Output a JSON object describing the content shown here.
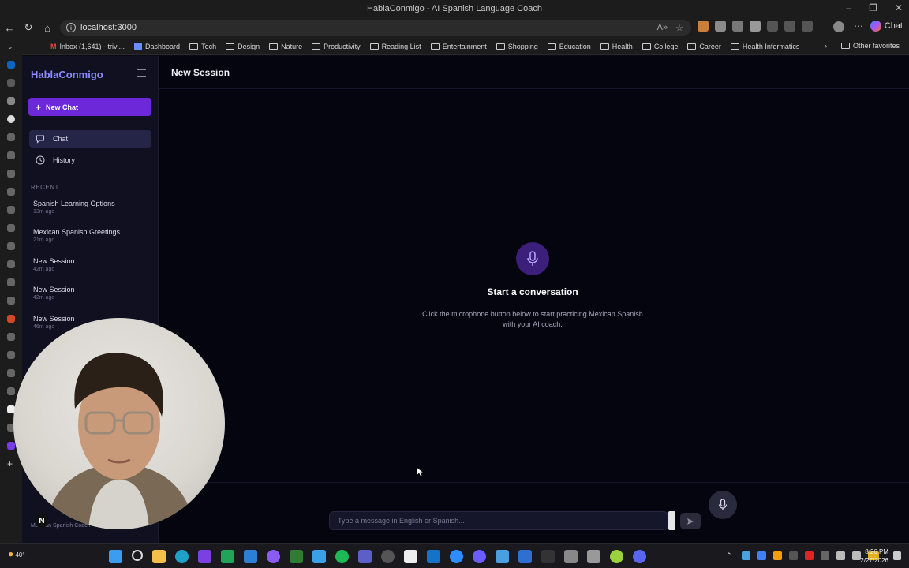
{
  "browser": {
    "window_title": "HablaConmigo - AI Spanish Language Coach",
    "url": "localhost:3000",
    "chat_label": "Chat",
    "bookmarks": [
      "Inbox (1,641) - trivi...",
      "Dashboard",
      "Tech",
      "Design",
      "Nature",
      "Productivity",
      "Reading List",
      "Entertainment",
      "Shopping",
      "Education",
      "Health",
      "College",
      "Career",
      "Health Informatics"
    ],
    "other_favorites": "Other favorites"
  },
  "sidebar": {
    "brand": "HablaConmigo",
    "new_chat": "New Chat",
    "nav": {
      "chat": "Chat",
      "history": "History"
    },
    "recent_label": "RECENT",
    "recent": [
      {
        "title": "Spanish Learning Options",
        "time": "13m ago"
      },
      {
        "title": "Mexican Spanish Greetings",
        "time": "21m ago"
      },
      {
        "title": "New Session",
        "time": "42m ago"
      },
      {
        "title": "New Session",
        "time": "42m ago"
      },
      {
        "title": "New Session",
        "time": "46m ago"
      }
    ],
    "footer": "Mexican Spanish Coach"
  },
  "main": {
    "title": "New Session",
    "empty_title": "Start a conversation",
    "empty_desc": "Click the microphone button below to start practicing Mexican Spanish with your AI coach.",
    "input_placeholder": "Type a message in English or Spanish..."
  },
  "taskbar": {
    "weather": "40°",
    "time": "8:26 PM",
    "date": "2/27/2026"
  },
  "webcam": {
    "badge": "N"
  },
  "colors": {
    "accent": "#6d28d9",
    "brand": "#8b8bff",
    "background": "#05050f"
  }
}
